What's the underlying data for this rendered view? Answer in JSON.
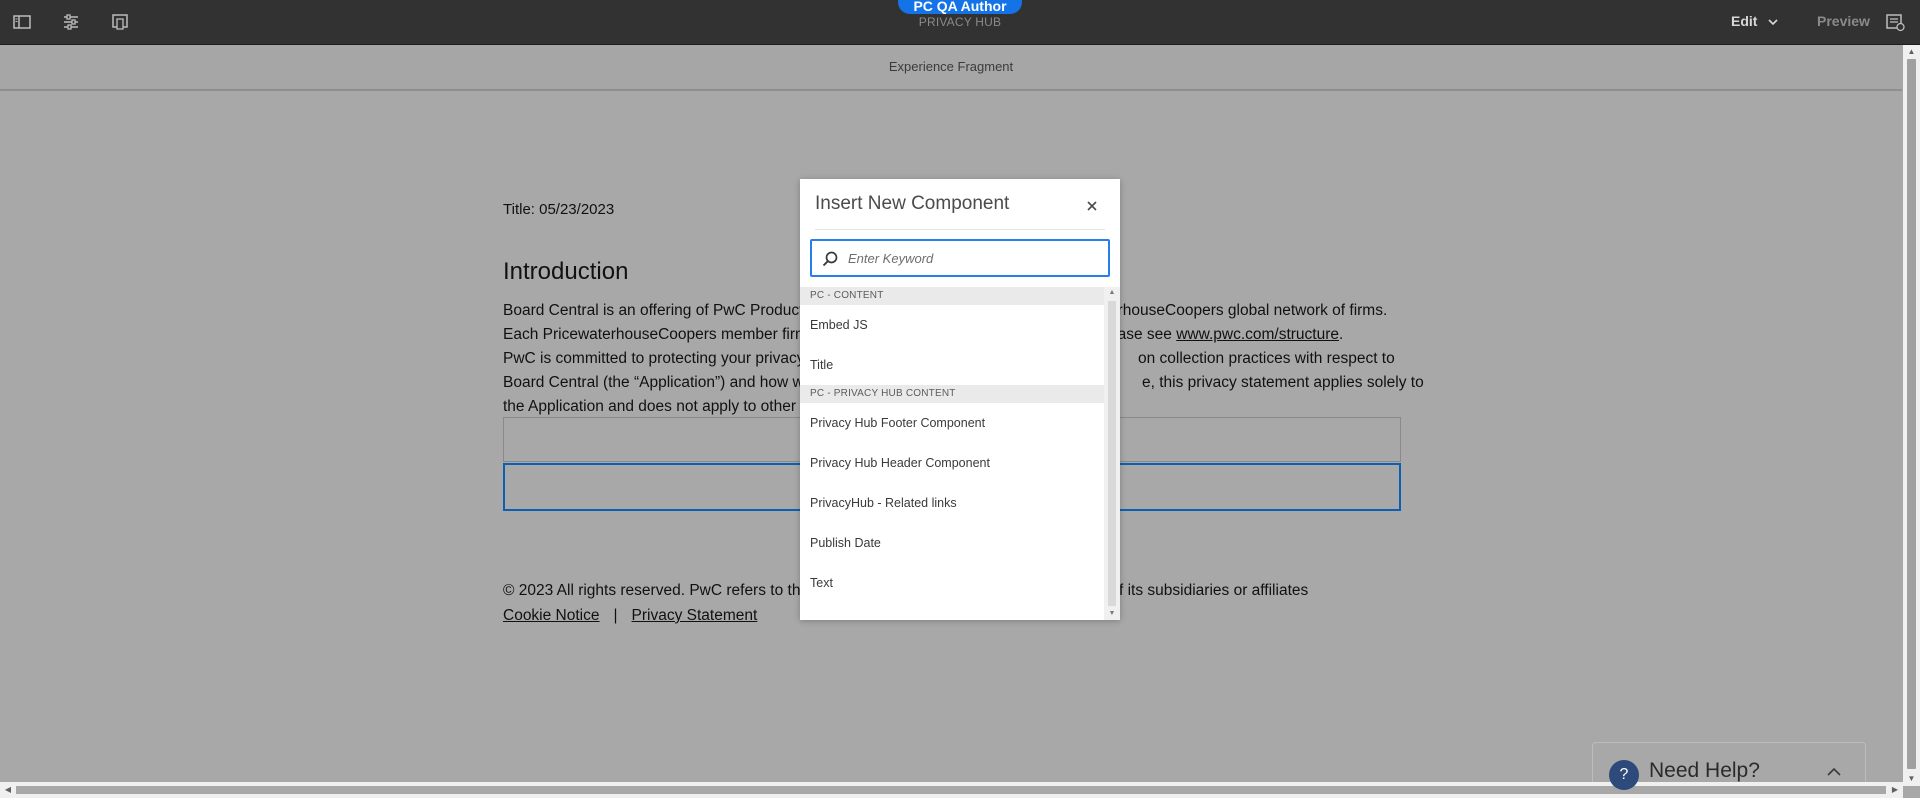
{
  "topbar": {
    "environment_label": "PC QA Author",
    "site_name": "PRIVACY HUB",
    "mode_label": "Edit",
    "preview_label": "Preview",
    "left_icons": [
      "toggle-side-panel-icon",
      "page-properties-icon",
      "emulator-icon"
    ],
    "right_icon": "annotations-icon"
  },
  "subheader": {
    "label": "Experience Fragment"
  },
  "page": {
    "title_date": "Title: 05/23/2023",
    "heading": "Introduction",
    "paragraph_lines": [
      {
        "left": "Board Central is an offering of PwC Product",
        "right": "erhouseCoopers global network of firms."
      },
      {
        "left": "Each PricewaterhouseCoopers member firm",
        "right_prefix": "ease see ",
        "link": "www.pwc.com/structure",
        "right_suffix": "."
      },
      {
        "left": "PwC is committed to protecting your privacy",
        "right": "on collection practices with respect to"
      },
      {
        "left": "Board Central (the “Application”) and how w",
        "right": "e, this privacy statement applies solely to"
      },
      {
        "left": "the Application and does not apply to other",
        "right": ""
      }
    ],
    "footer_text_left": "© 2023 All rights reserved. PwC refers to the",
    "footer_text_right": "f its subsidiaries or affiliates",
    "footer_links": [
      "Cookie Notice",
      "Privacy Statement"
    ],
    "footer_separator": "|"
  },
  "modal": {
    "title": "Insert New Component",
    "close_icon": "close-icon",
    "search": {
      "placeholder": "Enter Keyword",
      "value": ""
    },
    "groups": [
      {
        "name": "PC - CONTENT",
        "items": [
          "Embed JS",
          "Title"
        ]
      },
      {
        "name": "PC - PRIVACY HUB CONTENT",
        "items": [
          "Privacy Hub Footer Component",
          "Privacy Hub Header Component",
          "PrivacyHub - Related links",
          "Publish Date",
          "Text"
        ]
      }
    ]
  },
  "help_widget": {
    "label": "Need Help?",
    "icon": "question-icon"
  },
  "colors": {
    "accent": "#1473e6",
    "topbar": "#323232",
    "overlay": "#a8a8a8",
    "selection": "#0d5fb4"
  }
}
